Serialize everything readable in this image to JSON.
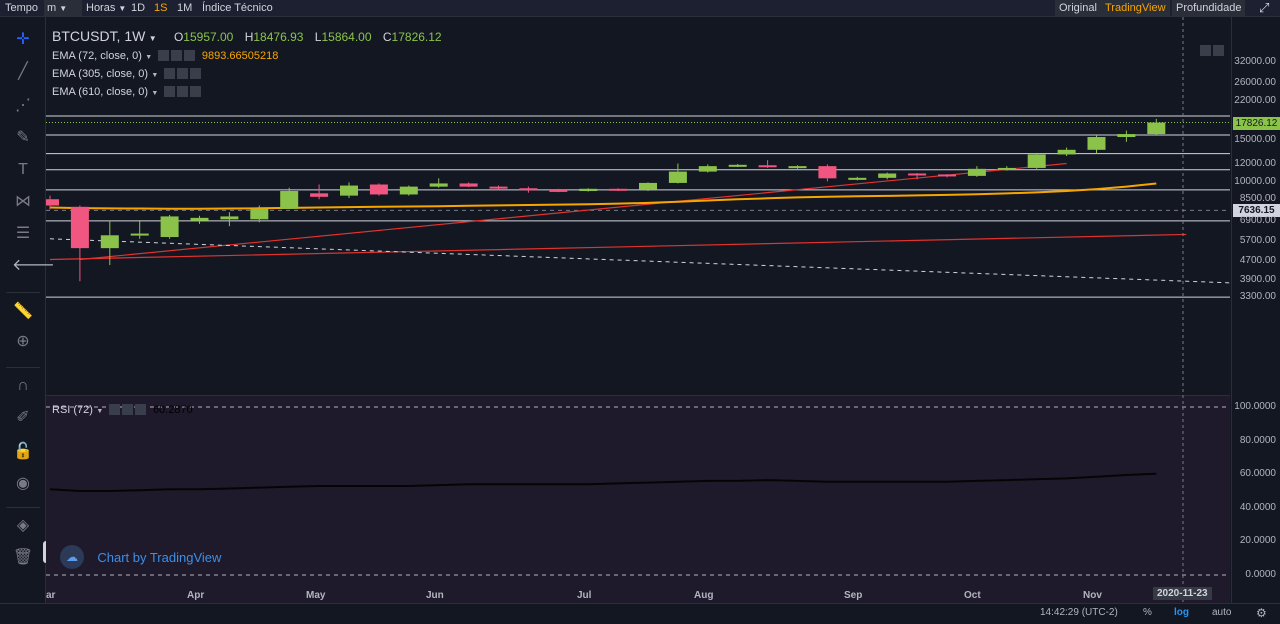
{
  "toolbar": {
    "tempo": "Tempo",
    "unit": "m",
    "horas": "Horas",
    "intervals": [
      "1D",
      "1S",
      "1M"
    ],
    "active_interval": "1S",
    "indicators": "Índice Técnico",
    "views": [
      "Original",
      "TradingView",
      "Profundidade"
    ],
    "active_view": "TradingView"
  },
  "legend": {
    "symbol": "BTCUSDT, 1W",
    "o_label": "O",
    "o": "15957.00",
    "h_label": "H",
    "h": "18476.93",
    "l_label": "L",
    "l": "15864.00",
    "c_label": "C",
    "c": "17826.12",
    "ema1": "EMA (72, close, 0)",
    "ema1_value": "9893.66505218",
    "ema2": "EMA (305, close, 0)",
    "ema3": "EMA (610, close, 0)",
    "rsi": "RSI (72)",
    "rsi_value": "60.2870"
  },
  "watermark": "Chart by TradingView",
  "bottom": {
    "time": "14:42:29 (UTC-2)",
    "percent": "%",
    "log": "log",
    "auto": "auto"
  },
  "colors": {
    "up": "#8bc34a",
    "down": "#f0567f",
    "ema": "#f7a600",
    "trend": "#e0332f",
    "rsi_bg": "#1e1a2c"
  },
  "chart_data": {
    "type": "candlestick",
    "price_axis_ticks": [
      "32000.00",
      "26000.00",
      "22000.00",
      "17826.12",
      "15000.00",
      "12000.00",
      "10000.00",
      "8500.00",
      "7636.15",
      "6900.00",
      "5700.00",
      "4700.00",
      "3900.00",
      "3300.00"
    ],
    "last_price": "17826.12",
    "marked_price": "7636.15",
    "x_labels": [
      "ar",
      "Apr",
      "May",
      "Jun",
      "Jul",
      "Aug",
      "Sep",
      "Oct",
      "Nov"
    ],
    "crosshair_date": "2020-11-23",
    "horizontal_levels": [
      19000,
      15800,
      13200,
      11300,
      9300,
      6900,
      3300
    ],
    "candles": [
      {
        "o": 8500,
        "h": 8800,
        "l": 7700,
        "c": 8000
      },
      {
        "o": 7900,
        "h": 8000,
        "l": 3850,
        "c": 5300
      },
      {
        "o": 5300,
        "h": 6900,
        "l": 4500,
        "c": 6000
      },
      {
        "o": 6000,
        "h": 6950,
        "l": 5800,
        "c": 6100
      },
      {
        "o": 5900,
        "h": 7300,
        "l": 5800,
        "c": 7200
      },
      {
        "o": 6900,
        "h": 7250,
        "l": 6700,
        "c": 7100
      },
      {
        "o": 7000,
        "h": 7500,
        "l": 6550,
        "c": 7200
      },
      {
        "o": 7000,
        "h": 8000,
        "l": 6800,
        "c": 7750
      },
      {
        "o": 7750,
        "h": 9500,
        "l": 7750,
        "c": 9200
      },
      {
        "o": 9000,
        "h": 9800,
        "l": 8500,
        "c": 8700
      },
      {
        "o": 8800,
        "h": 10000,
        "l": 8600,
        "c": 9700
      },
      {
        "o": 9800,
        "h": 9900,
        "l": 8800,
        "c": 8900
      },
      {
        "o": 8900,
        "h": 9700,
        "l": 8800,
        "c": 9600
      },
      {
        "o": 9600,
        "h": 10400,
        "l": 9500,
        "c": 9900
      },
      {
        "o": 9900,
        "h": 10000,
        "l": 9550,
        "c": 9600
      },
      {
        "o": 9600,
        "h": 9700,
        "l": 9300,
        "c": 9450
      },
      {
        "o": 9450,
        "h": 9600,
        "l": 9050,
        "c": 9300
      },
      {
        "o": 9300,
        "h": 9400,
        "l": 9100,
        "c": 9200
      },
      {
        "o": 9200,
        "h": 9450,
        "l": 9150,
        "c": 9400
      },
      {
        "o": 9400,
        "h": 9450,
        "l": 9200,
        "c": 9300
      },
      {
        "o": 9300,
        "h": 10000,
        "l": 9200,
        "c": 9950
      },
      {
        "o": 9950,
        "h": 12000,
        "l": 9900,
        "c": 11100
      },
      {
        "o": 11100,
        "h": 11900,
        "l": 11000,
        "c": 11700
      },
      {
        "o": 11700,
        "h": 11950,
        "l": 11600,
        "c": 11850
      },
      {
        "o": 11800,
        "h": 12400,
        "l": 11500,
        "c": 11600
      },
      {
        "o": 11600,
        "h": 11800,
        "l": 11400,
        "c": 11700
      },
      {
        "o": 11700,
        "h": 11900,
        "l": 10100,
        "c": 10400
      },
      {
        "o": 10400,
        "h": 10550,
        "l": 10200,
        "c": 10450
      },
      {
        "o": 10450,
        "h": 11000,
        "l": 10300,
        "c": 10900
      },
      {
        "o": 10900,
        "h": 10950,
        "l": 10300,
        "c": 10800
      },
      {
        "o": 10800,
        "h": 10850,
        "l": 10500,
        "c": 10650
      },
      {
        "o": 10650,
        "h": 11700,
        "l": 10550,
        "c": 11400
      },
      {
        "o": 11400,
        "h": 11700,
        "l": 11200,
        "c": 11500
      },
      {
        "o": 11500,
        "h": 13300,
        "l": 11400,
        "c": 13100
      },
      {
        "o": 13100,
        "h": 14000,
        "l": 12900,
        "c": 13700
      },
      {
        "o": 13700,
        "h": 15800,
        "l": 13200,
        "c": 15500
      },
      {
        "o": 15500,
        "h": 16500,
        "l": 14800,
        "c": 15950
      },
      {
        "o": 15957,
        "h": 18476.93,
        "l": 15864,
        "c": 17826.12
      }
    ],
    "ema72": [
      7850,
      7800,
      7780,
      7770,
      7760,
      7760,
      7770,
      7790,
      7820,
      7850,
      7880,
      7900,
      7920,
      7950,
      7980,
      8010,
      8040,
      8070,
      8100,
      8150,
      8200,
      8300,
      8400,
      8500,
      8580,
      8650,
      8700,
      8740,
      8780,
      8820,
      8860,
      8920,
      8990,
      9080,
      9200,
      9370,
      9600,
      9893.67
    ],
    "trend_lines": [
      {
        "from": [
          1,
          4750
        ],
        "to": [
          34,
          12000
        ]
      },
      {
        "from": [
          0,
          4750
        ],
        "to": [
          38,
          6050
        ]
      }
    ],
    "dashed_trend": {
      "from": [
        0,
        5800
      ],
      "to": [
        38,
        3950
      ]
    },
    "rsi": {
      "title": "RSI (72)",
      "ticks": [
        "100.0000",
        "80.0000",
        "60.0000",
        "40.0000",
        "20.0000",
        "0.0000"
      ],
      "values": [
        51,
        50,
        50,
        50.5,
        51,
        51,
        51.5,
        52,
        52.5,
        53,
        53,
        53,
        53,
        53.5,
        54,
        54,
        54,
        54,
        54,
        54.5,
        55,
        55.5,
        56,
        56,
        56.5,
        56,
        55.5,
        55.5,
        55.5,
        55.5,
        55.5,
        56,
        56.5,
        57,
        57.5,
        58.5,
        59.5,
        60.287
      ]
    }
  }
}
